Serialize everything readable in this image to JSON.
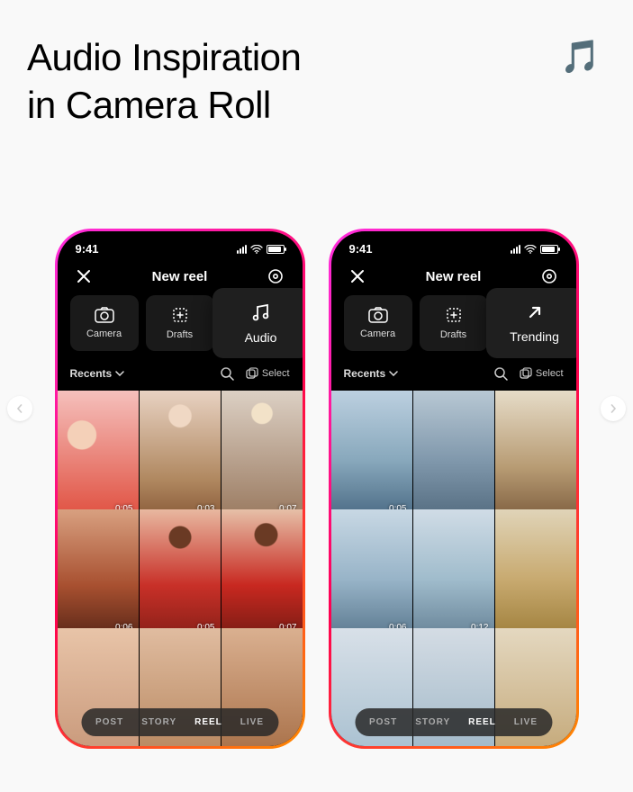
{
  "header": {
    "title_line1": "Audio Inspiration",
    "title_line2": "in Camera Roll",
    "icon": "🎵"
  },
  "status": {
    "time": "9:41"
  },
  "topbar": {
    "title": "New reel"
  },
  "tools": {
    "camera": "Camera",
    "drafts": "Drafts"
  },
  "popover": {
    "left": "Audio",
    "right": "Trending"
  },
  "filter": {
    "label": "Recents",
    "select": "Select"
  },
  "modes": {
    "post": "POST",
    "story": "STORY",
    "reel": "REEL",
    "live": "LIVE"
  },
  "phone_left": {
    "durations": [
      "0:05",
      "0:03",
      "0:07",
      "0:06",
      "0:05",
      "0:07"
    ]
  },
  "phone_right": {
    "durations": [
      "0:05",
      "",
      "",
      "0:06",
      "0:12",
      ""
    ]
  }
}
